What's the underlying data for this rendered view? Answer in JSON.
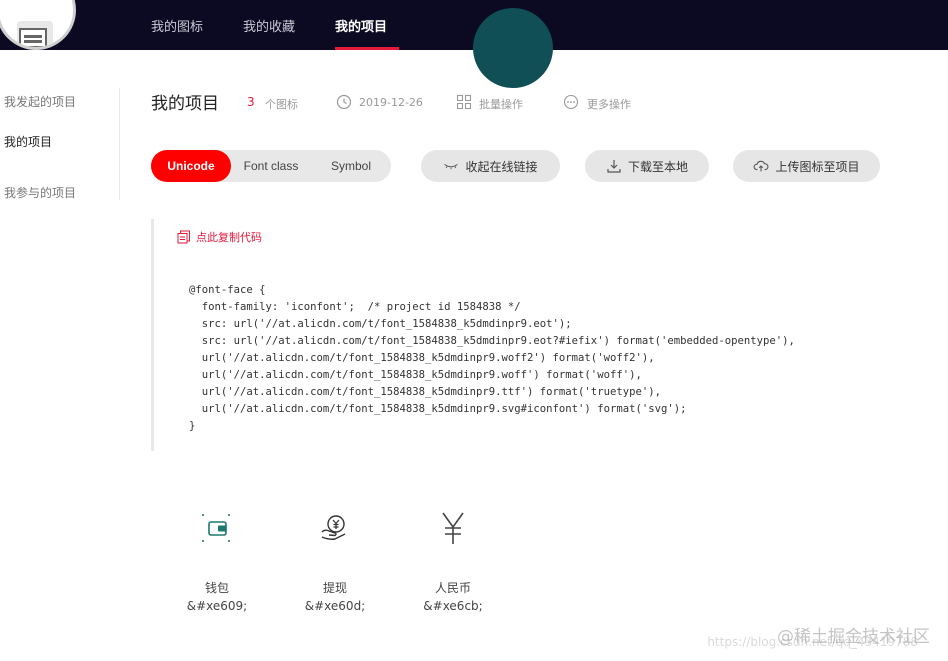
{
  "nav": {
    "items": [
      "我的图标",
      "我的收藏",
      "我的项目"
    ],
    "active": "我的项目"
  },
  "sidebar": {
    "items": [
      "我发起的项目",
      "我的项目",
      "我参与的项目"
    ]
  },
  "header": {
    "title": "我的项目",
    "icon_count": "3",
    "icon_count_label": "个图标",
    "date": "2019-12-26",
    "batch_label": "批量操作",
    "more_label": "更多操作"
  },
  "tabs": [
    "Unicode",
    "Font class",
    "Symbol"
  ],
  "actions": {
    "collapse": "收起在线链接",
    "download": "下载至本地",
    "upload": "上传图标至项目"
  },
  "code": {
    "copy_label": "点此复制代码",
    "lines": [
      "@font-face {",
      "  font-family: 'iconfont';  /* project id 1584838 */",
      "  src: url('//at.alicdn.com/t/font_1584838_k5dmdinpr9.eot');",
      "  src: url('//at.alicdn.com/t/font_1584838_k5dmdinpr9.eot?#iefix') format('embedded-opentype'),",
      "  url('//at.alicdn.com/t/font_1584838_k5dmdinpr9.woff2') format('woff2'),",
      "  url('//at.alicdn.com/t/font_1584838_k5dmdinpr9.woff') format('woff'),",
      "  url('//at.alicdn.com/t/font_1584838_k5dmdinpr9.ttf') format('truetype'),",
      "  url('//at.alicdn.com/t/font_1584838_k5dmdinpr9.svg#iconfont') format('svg');",
      "}"
    ]
  },
  "icons": [
    {
      "name": "钱包",
      "code": "&#xe609;",
      "icon": "wallet-icon"
    },
    {
      "name": "提现",
      "code": "&#xe60d;",
      "icon": "withdraw-icon"
    },
    {
      "name": "人民币",
      "code": "&#xe6cb;",
      "icon": "yuan-icon"
    }
  ],
  "watermark": {
    "text": "@稀土掘金技术社区",
    "url": "https://blog.csdn.net/qq_43419788"
  },
  "colors": {
    "accent": "#ff0000",
    "nav_bg": "#0c0a22",
    "link_red": "#e5193a"
  }
}
